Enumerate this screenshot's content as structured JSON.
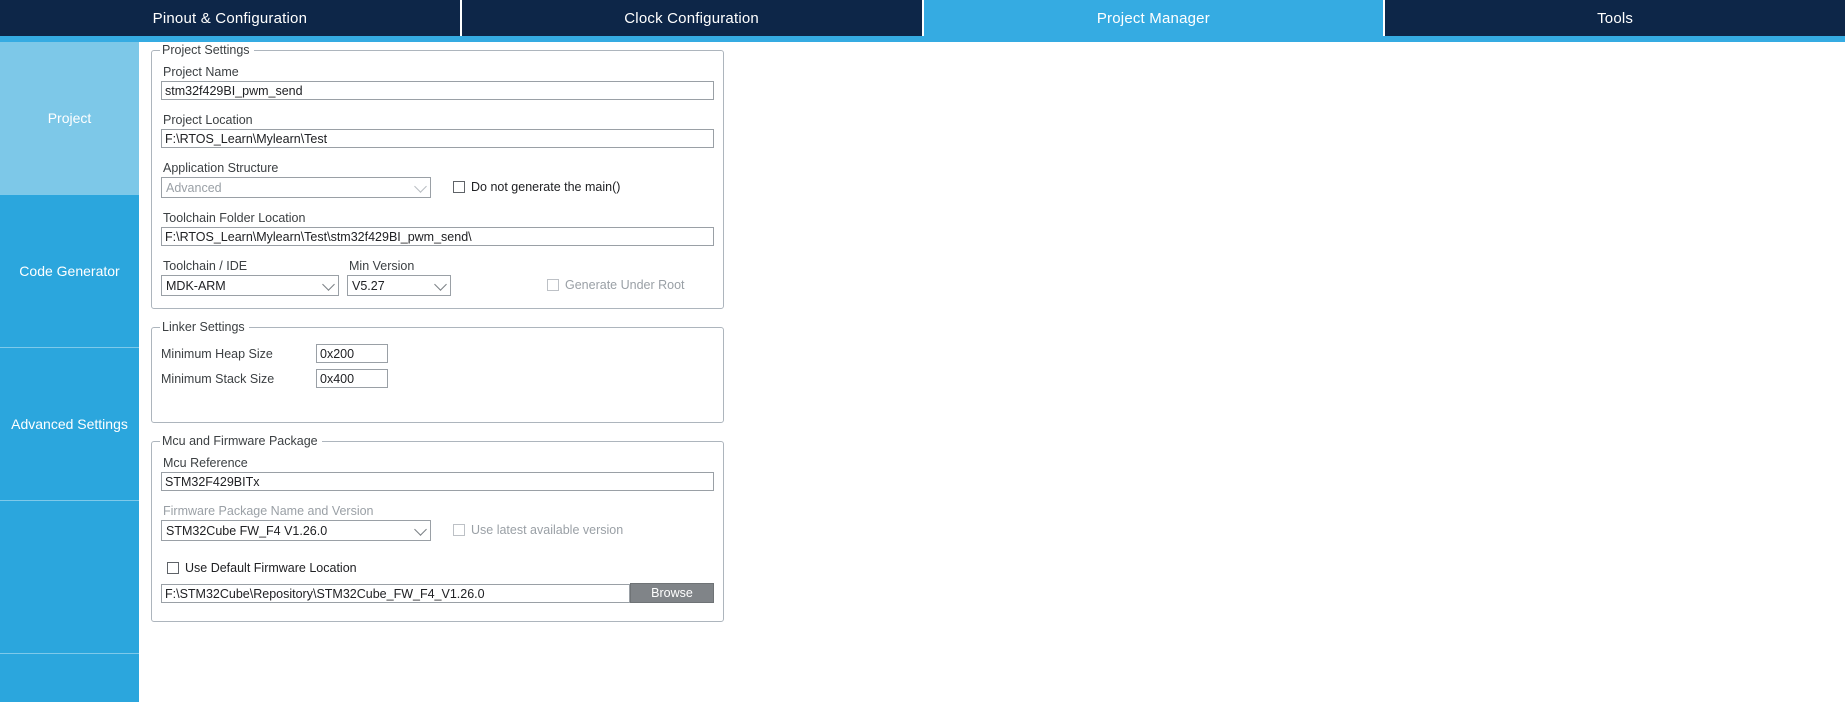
{
  "tabs": [
    {
      "label": "Pinout & Configuration",
      "active": false
    },
    {
      "label": "Clock Configuration",
      "active": false
    },
    {
      "label": "Project Manager",
      "active": true
    },
    {
      "label": "Tools",
      "active": false
    }
  ],
  "sidebar": {
    "items": [
      {
        "label": "Project",
        "selected": true
      },
      {
        "label": "Code Generator",
        "selected": false
      },
      {
        "label": "Advanced Settings",
        "selected": false
      },
      {
        "label": "",
        "selected": false
      }
    ]
  },
  "project_settings": {
    "group_title": "Project Settings",
    "project_name_label": "Project Name",
    "project_name_value": "stm32f429BI_pwm_send",
    "project_location_label": "Project Location",
    "project_location_value": "F:\\RTOS_Learn\\Mylearn\\Test",
    "application_structure_label": "Application Structure",
    "application_structure_value": "Advanced",
    "do_not_generate_main_label": "Do not generate the main()",
    "do_not_generate_main_checked": false,
    "toolchain_folder_label": "Toolchain Folder Location",
    "toolchain_folder_value": "F:\\RTOS_Learn\\Mylearn\\Test\\stm32f429BI_pwm_send\\",
    "toolchain_ide_label": "Toolchain / IDE",
    "toolchain_ide_value": "MDK-ARM",
    "min_version_label": "Min Version",
    "min_version_value": "V5.27",
    "generate_under_root_label": "Generate Under Root",
    "generate_under_root_checked": false
  },
  "linker_settings": {
    "group_title": "Linker Settings",
    "min_heap_label": "Minimum Heap Size",
    "min_heap_value": "0x200",
    "min_stack_label": "Minimum Stack Size",
    "min_stack_value": "0x400"
  },
  "mcu_firmware": {
    "group_title": "Mcu and Firmware Package",
    "mcu_reference_label": "Mcu Reference",
    "mcu_reference_value": "STM32F429BITx",
    "firmware_package_label": "Firmware Package Name and Version",
    "firmware_package_value": "STM32Cube FW_F4 V1.26.0",
    "use_latest_label": "Use latest available version",
    "use_latest_checked": false,
    "use_default_location_label": "Use Default Firmware Location",
    "use_default_location_checked": false,
    "firmware_location_value": "F:\\STM32Cube\\Repository\\STM32Cube_FW_F4_V1.26.0",
    "browse_label": "Browse"
  },
  "colors": {
    "tab_inactive": "#0d2648",
    "tab_active": "#35abe2",
    "sidebar": "#2ba6dd",
    "sidebar_selected": "#7dc8e8",
    "accent": "#35abe2"
  }
}
